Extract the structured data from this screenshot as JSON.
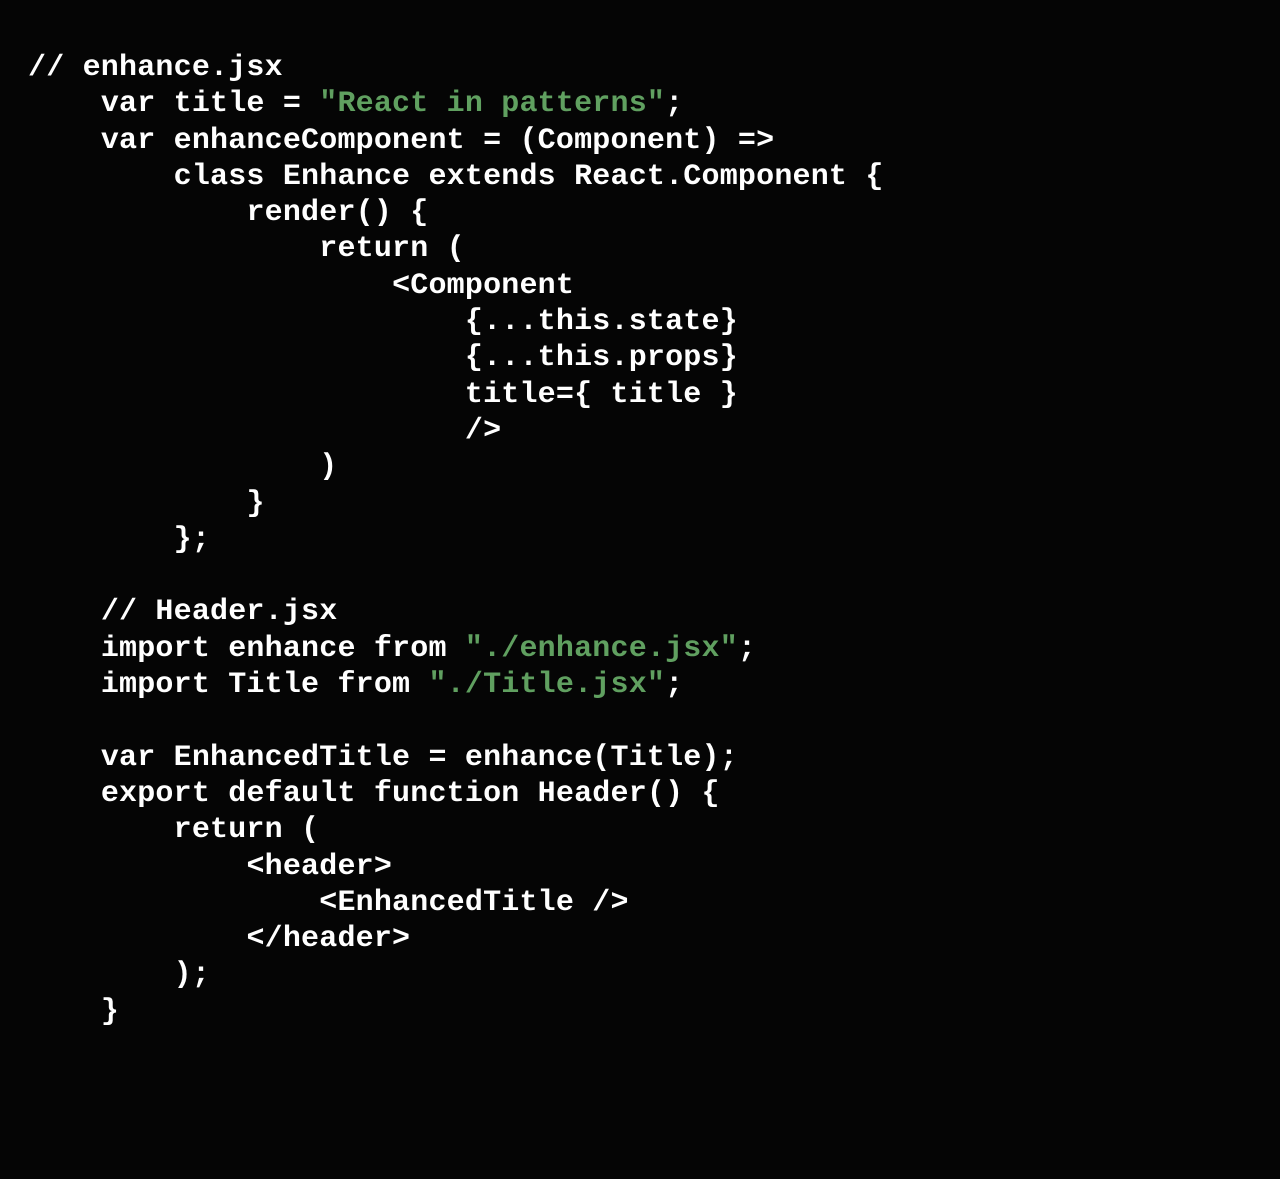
{
  "code": {
    "lines": [
      {
        "indent": 0,
        "segments": [
          {
            "t": "plain",
            "v": "// enhance.jsx"
          }
        ]
      },
      {
        "indent": 4,
        "segments": [
          {
            "t": "plain",
            "v": "var title = "
          },
          {
            "t": "str",
            "v": "\"React in patterns\""
          },
          {
            "t": "plain",
            "v": ";"
          }
        ]
      },
      {
        "indent": 4,
        "segments": [
          {
            "t": "plain",
            "v": "var enhanceComponent = (Component) =>"
          }
        ]
      },
      {
        "indent": 8,
        "segments": [
          {
            "t": "plain",
            "v": "class Enhance extends React.Component {"
          }
        ]
      },
      {
        "indent": 12,
        "segments": [
          {
            "t": "plain",
            "v": "render() {"
          }
        ]
      },
      {
        "indent": 16,
        "segments": [
          {
            "t": "plain",
            "v": "return ("
          }
        ]
      },
      {
        "indent": 20,
        "segments": [
          {
            "t": "plain",
            "v": "<Component"
          }
        ]
      },
      {
        "indent": 24,
        "segments": [
          {
            "t": "plain",
            "v": "{...this.state}"
          }
        ]
      },
      {
        "indent": 24,
        "segments": [
          {
            "t": "plain",
            "v": "{...this.props}"
          }
        ]
      },
      {
        "indent": 24,
        "segments": [
          {
            "t": "plain",
            "v": "title={ title }"
          }
        ]
      },
      {
        "indent": 24,
        "segments": [
          {
            "t": "plain",
            "v": "/>"
          }
        ]
      },
      {
        "indent": 16,
        "segments": [
          {
            "t": "plain",
            "v": ")"
          }
        ]
      },
      {
        "indent": 12,
        "segments": [
          {
            "t": "plain",
            "v": "}"
          }
        ]
      },
      {
        "indent": 8,
        "segments": [
          {
            "t": "plain",
            "v": "};"
          }
        ]
      },
      {
        "indent": 0,
        "segments": [
          {
            "t": "plain",
            "v": ""
          }
        ]
      },
      {
        "indent": 4,
        "segments": [
          {
            "t": "plain",
            "v": "// Header.jsx"
          }
        ]
      },
      {
        "indent": 4,
        "segments": [
          {
            "t": "plain",
            "v": "import enhance from "
          },
          {
            "t": "str",
            "v": "\"./enhance.jsx\""
          },
          {
            "t": "plain",
            "v": ";"
          }
        ]
      },
      {
        "indent": 4,
        "segments": [
          {
            "t": "plain",
            "v": "import Title from "
          },
          {
            "t": "str",
            "v": "\"./Title.jsx\""
          },
          {
            "t": "plain",
            "v": ";"
          }
        ]
      },
      {
        "indent": 0,
        "segments": [
          {
            "t": "plain",
            "v": ""
          }
        ]
      },
      {
        "indent": 4,
        "segments": [
          {
            "t": "plain",
            "v": "var EnhancedTitle = enhance(Title);"
          }
        ]
      },
      {
        "indent": 4,
        "segments": [
          {
            "t": "plain",
            "v": "export default function Header() {"
          }
        ]
      },
      {
        "indent": 8,
        "segments": [
          {
            "t": "plain",
            "v": "return ("
          }
        ]
      },
      {
        "indent": 12,
        "segments": [
          {
            "t": "plain",
            "v": "<header>"
          }
        ]
      },
      {
        "indent": 16,
        "segments": [
          {
            "t": "plain",
            "v": "<EnhancedTitle />"
          }
        ]
      },
      {
        "indent": 12,
        "segments": [
          {
            "t": "plain",
            "v": "</header>"
          }
        ]
      },
      {
        "indent": 8,
        "segments": [
          {
            "t": "plain",
            "v": ");"
          }
        ]
      },
      {
        "indent": 4,
        "segments": [
          {
            "t": "plain",
            "v": "}"
          }
        ]
      }
    ]
  }
}
